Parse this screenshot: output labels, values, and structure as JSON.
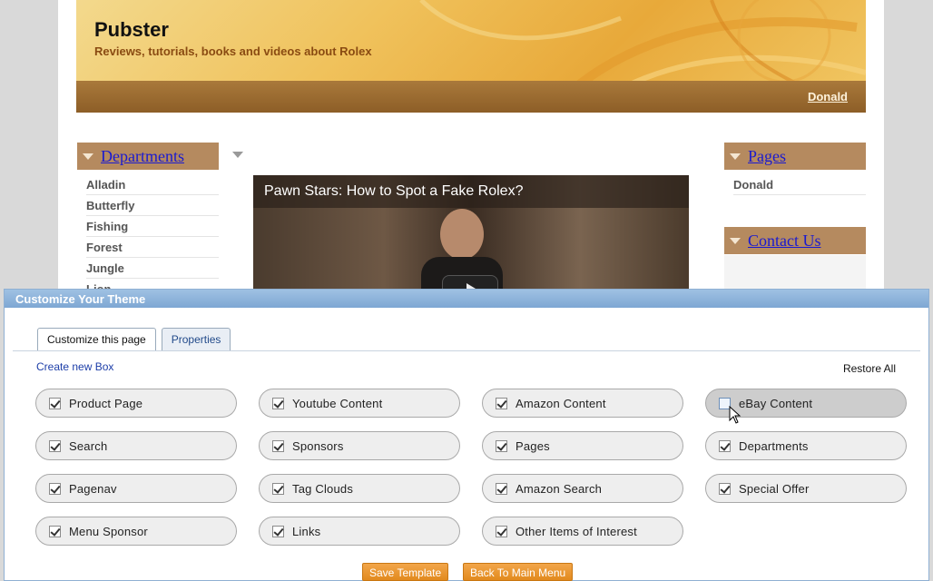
{
  "site": {
    "title": "Pubster",
    "tagline": "Reviews, tutorials, books and videos about Rolex",
    "user": "Donald",
    "colors": {
      "banner": "#f0c25c",
      "box_header": "#b58a5f",
      "link": "#1a1ad0"
    }
  },
  "departments": {
    "title": "Departments",
    "items": [
      "Alladin",
      "Butterfly",
      "Fishing",
      "Forest",
      "Jungle",
      "Lion"
    ]
  },
  "pages_box": {
    "title": "Pages",
    "items": [
      "Donald"
    ]
  },
  "contact_box": {
    "title": "Contact Us"
  },
  "video": {
    "title": "Pawn Stars: How to Spot a Fake Rolex?"
  },
  "panel": {
    "title": "Customize Your Theme",
    "tabs": [
      {
        "label": "Customize this page",
        "active": true
      },
      {
        "label": "Properties",
        "active": false
      }
    ],
    "create_box_label": "Create new Box",
    "restore_all_label": "Restore All",
    "options": [
      {
        "label": "Product Page",
        "checked": true
      },
      {
        "label": "Youtube Content",
        "checked": true
      },
      {
        "label": "Amazon Content",
        "checked": true
      },
      {
        "label": "eBay Content",
        "checked": false
      },
      {
        "label": "Search",
        "checked": true
      },
      {
        "label": "Sponsors",
        "checked": true
      },
      {
        "label": "Pages",
        "checked": true
      },
      {
        "label": "Departments",
        "checked": true
      },
      {
        "label": "Pagenav",
        "checked": true
      },
      {
        "label": "Tag Clouds",
        "checked": true
      },
      {
        "label": "Amazon Search",
        "checked": true
      },
      {
        "label": "Special Offer",
        "checked": true
      },
      {
        "label": "Menu Sponsor",
        "checked": true
      },
      {
        "label": "Links",
        "checked": true
      },
      {
        "label": "Other Items of Interest",
        "checked": true
      }
    ],
    "save_label": "Save Template",
    "back_label": "Back To Main Menu",
    "colors": {
      "header": "#8fb0d3",
      "button": "#e8961f"
    }
  }
}
